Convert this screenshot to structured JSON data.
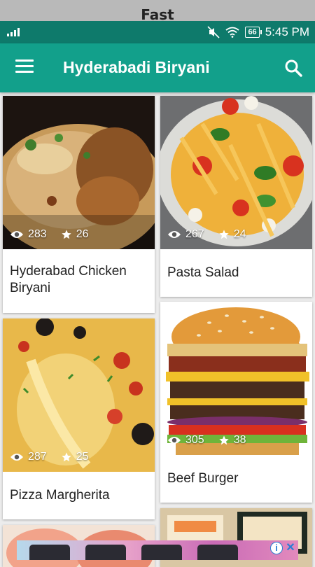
{
  "top_label": "Fast",
  "status_bar": {
    "time": "5:45 PM",
    "battery": "66"
  },
  "app_bar": {
    "title": "Hyderabadi Biryani"
  },
  "recipes": [
    {
      "name": "Hyderabad Chicken Biryani",
      "views": "283",
      "likes": "26"
    },
    {
      "name": "Pasta Salad",
      "views": "267",
      "likes": "24"
    },
    {
      "name": "Pizza Margherita",
      "views": "287",
      "likes": "25"
    },
    {
      "name": "Beef Burger",
      "views": "305",
      "likes": "38"
    }
  ],
  "colors": {
    "status_bar": "#0e7a6b",
    "app_bar": "#12a08b"
  },
  "icons": [
    "signal-icon",
    "mute-icon",
    "wifi-icon",
    "battery-icon",
    "menu-icon",
    "search-icon",
    "eye-icon",
    "star-icon",
    "ad-info-icon",
    "ad-close-icon"
  ]
}
